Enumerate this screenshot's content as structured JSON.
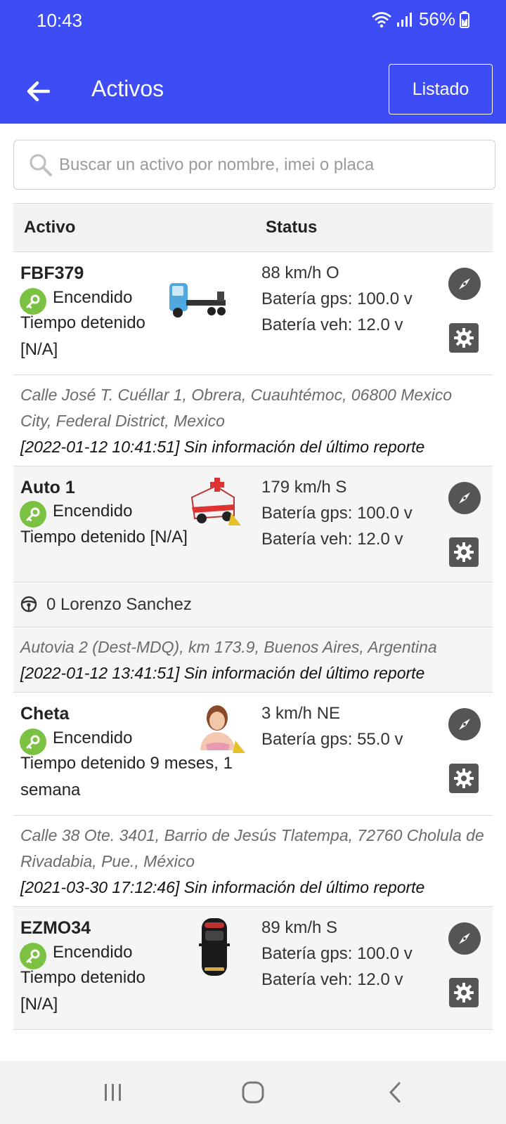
{
  "status_bar": {
    "time": "10:43",
    "battery": "56%"
  },
  "toolbar": {
    "title": "Activos",
    "list_button": "Listado"
  },
  "search": {
    "placeholder": "Buscar un activo por nombre, imei o placa"
  },
  "table": {
    "headers": {
      "asset": "Activo",
      "status": "Status"
    },
    "assets": [
      {
        "name": "FBF379",
        "power": "Encendido",
        "stopped": "Tiempo detenido [N/A]",
        "speed": "88 km/h O",
        "gps_battery": "Batería gps: 100.0 v",
        "veh_battery": "Batería veh: 12.0 v",
        "address": "Calle José T. Cuéllar 1, Obrera, Cuauhtémoc, 06800 Mexico City, Federal District, Mexico",
        "report": "[2022-01-12 10:41:51] Sin información del último reporte"
      },
      {
        "name": "Auto 1",
        "power": "Encendido",
        "stopped": "Tiempo detenido [N/A]",
        "speed": "179 km/h S",
        "gps_battery": "Batería gps: 100.0 v",
        "veh_battery": "Batería veh: 12.0 v",
        "driver": "0 Lorenzo Sanchez",
        "address": "Autovia 2 (Dest-MDQ), km 173.9, Buenos Aires, Argentina",
        "report": "[2022-01-12 13:41:51] Sin información del último reporte"
      },
      {
        "name": "Cheta",
        "power": "Encendido",
        "stopped": "Tiempo detenido 9 meses, 1 semana",
        "speed": "3 km/h NE",
        "gps_battery": "Batería gps: 55.0 v",
        "address": "Calle 38 Ote. 3401, Barrio de Jesús Tlatempa, 72760 Cholula de Rivadabia, Pue., México",
        "report": "[2021-03-30 17:12:46] Sin información del último reporte"
      },
      {
        "name": "EZMO34",
        "power": "Encendido",
        "stopped": "Tiempo detenido [N/A]",
        "speed": "89 km/h S",
        "gps_battery": "Batería gps: 100.0 v",
        "veh_battery": "Batería veh: 12.0 v"
      }
    ]
  },
  "colors": {
    "appbar": "#3d4cf4",
    "key_green": "#7cc242",
    "action_gray": "#555555"
  }
}
